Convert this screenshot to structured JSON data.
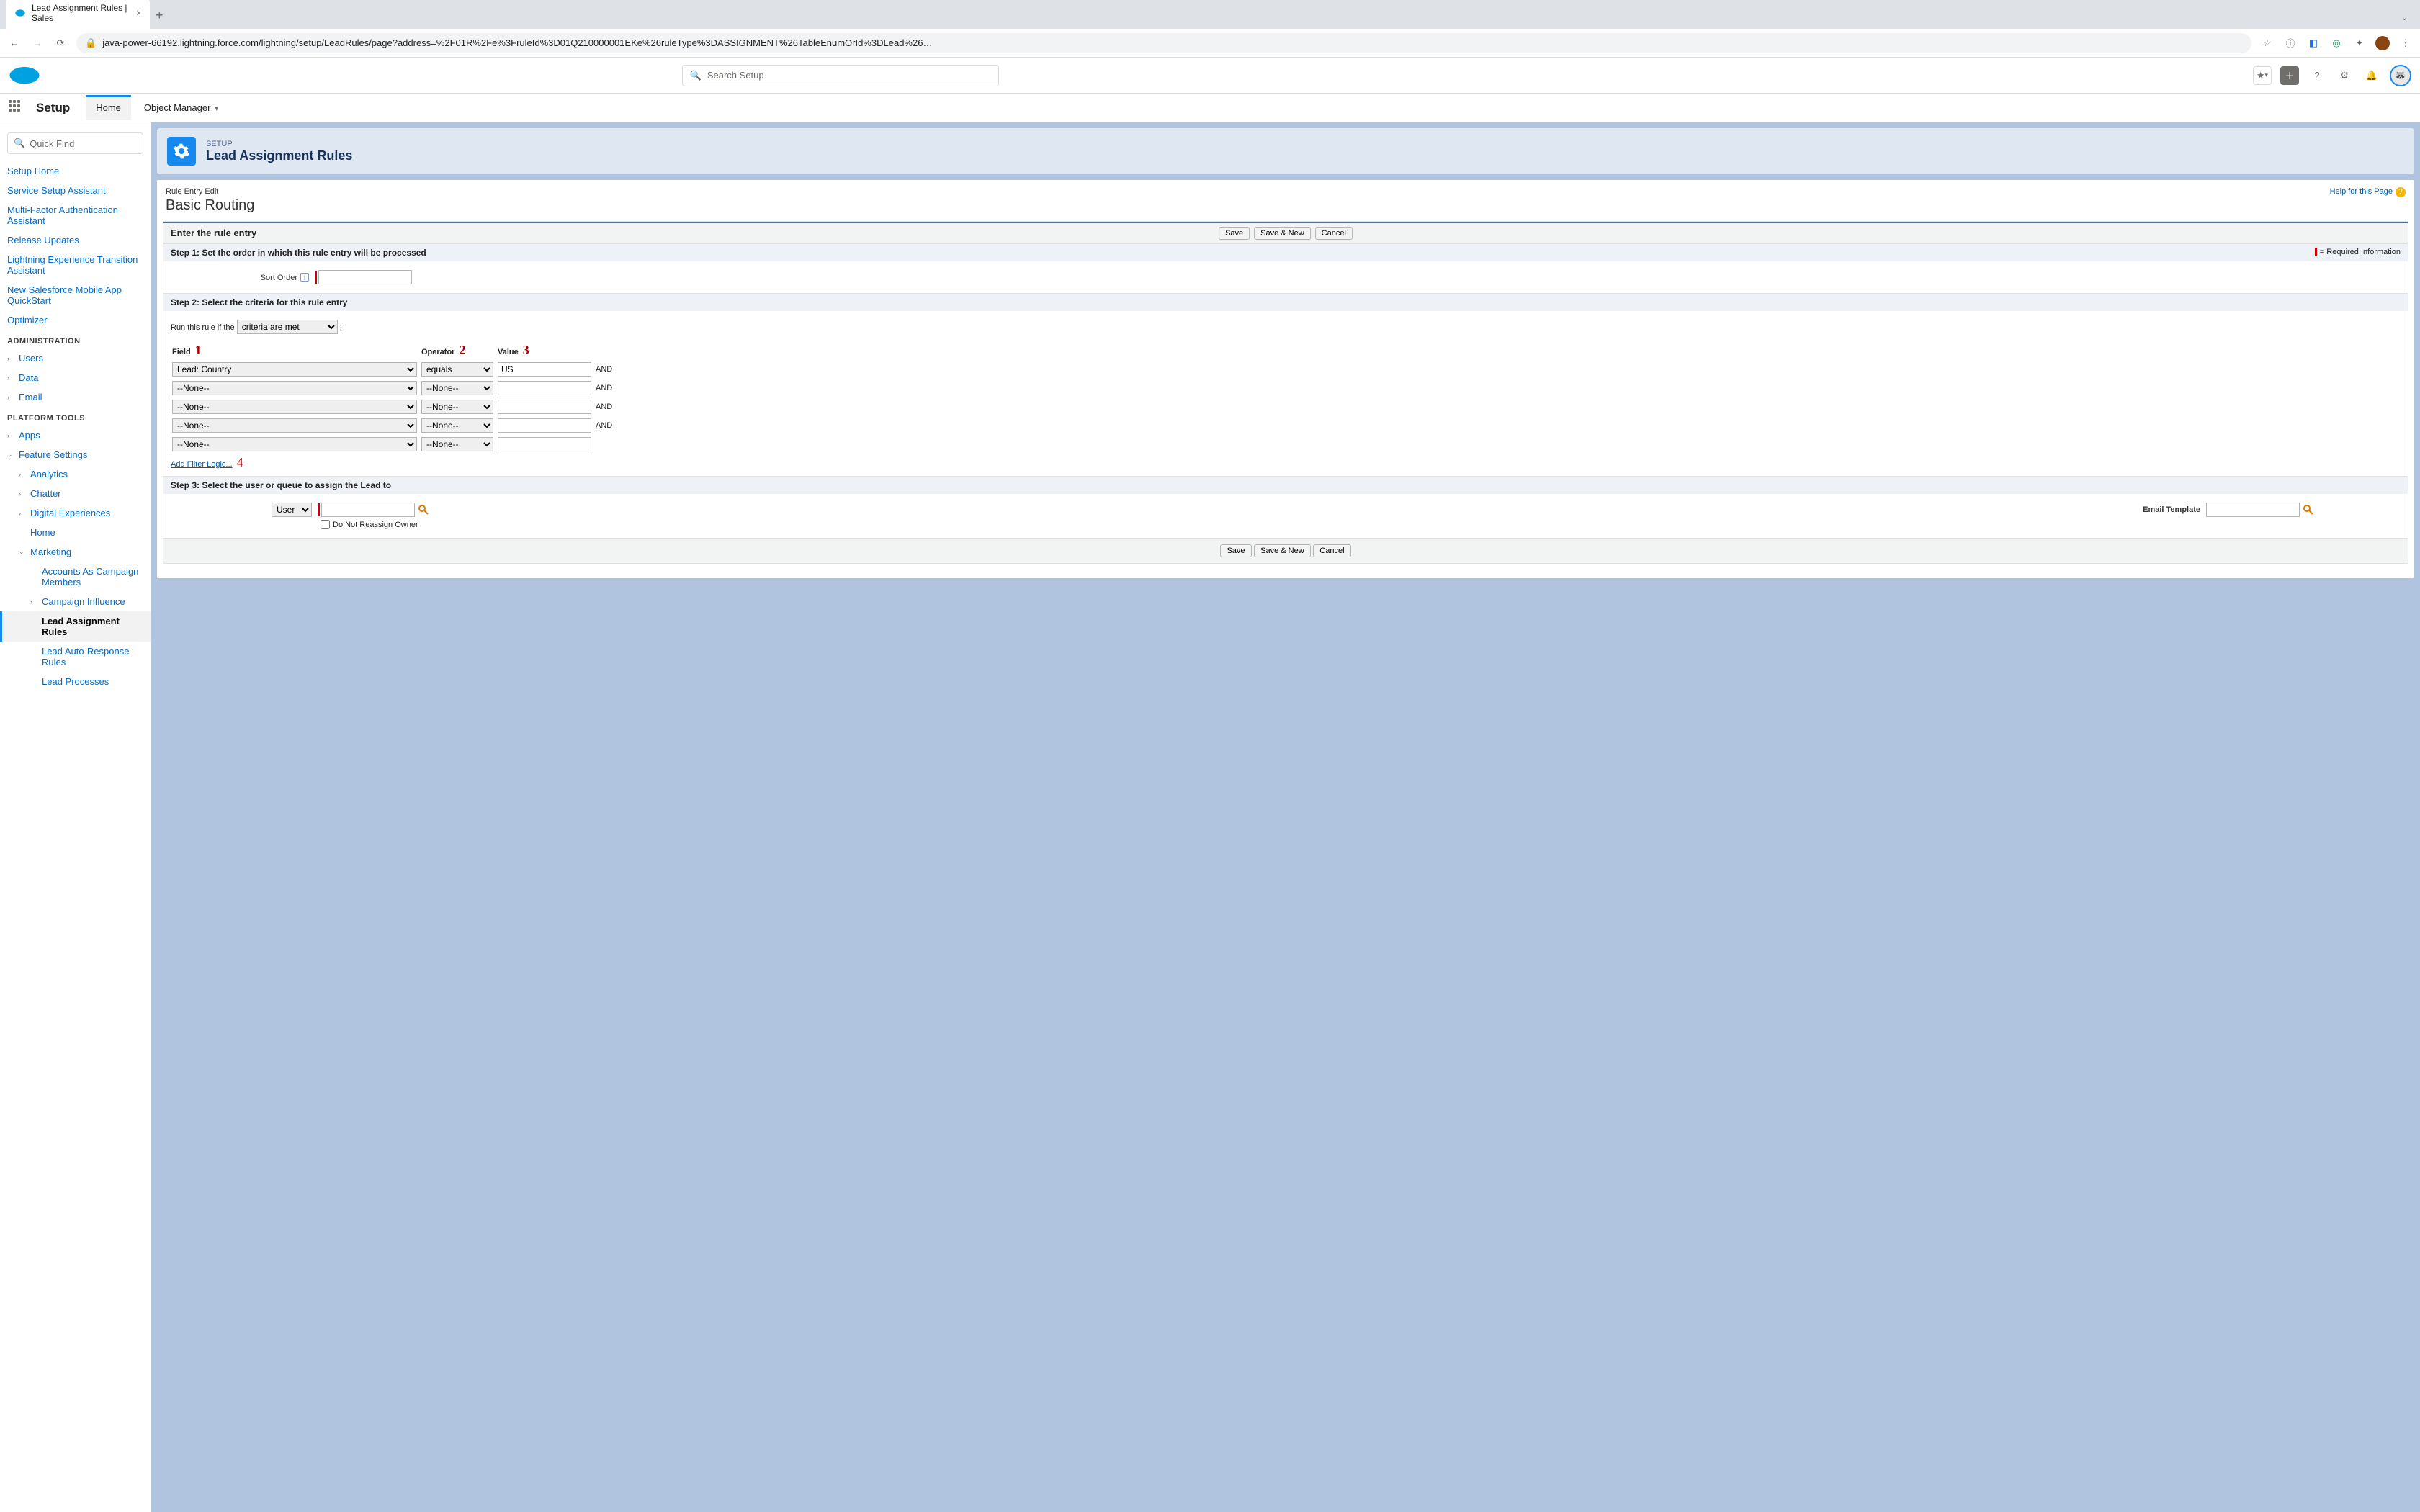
{
  "browser": {
    "tab_title": "Lead Assignment Rules | Sales",
    "url": "java-power-66192.lightning.force.com/lightning/setup/LeadRules/page?address=%2F01R%2Fe%3FruleId%3D01Q210000001EKe%26ruleType%3DASSIGNMENT%26TableEnumOrId%3DLead%26…"
  },
  "sf_header": {
    "search_placeholder": "Search Setup"
  },
  "nav": {
    "setup": "Setup",
    "home": "Home",
    "object_manager": "Object Manager"
  },
  "sidebar": {
    "quick_find": "Quick Find",
    "top": [
      "Setup Home",
      "Service Setup Assistant",
      "Multi-Factor Authentication Assistant",
      "Release Updates",
      "Lightning Experience Transition Assistant",
      "New Salesforce Mobile App QuickStart",
      "Optimizer"
    ],
    "section_admin": "ADMINISTRATION",
    "admin": [
      "Users",
      "Data",
      "Email"
    ],
    "section_platform": "PLATFORM TOOLS",
    "apps": "Apps",
    "feature_settings": "Feature Settings",
    "feature_children": [
      "Analytics",
      "Chatter",
      "Digital Experiences",
      "Home"
    ],
    "marketing": "Marketing",
    "marketing_children": [
      "Accounts As Campaign Members",
      "Campaign Influence",
      "Lead Assignment Rules",
      "Lead Auto-Response Rules",
      "Lead Processes"
    ]
  },
  "hero": {
    "kicker": "SETUP",
    "title": "Lead Assignment Rules"
  },
  "classic": {
    "help": "Help for this Page",
    "breadcrumb": "Rule Entry Edit",
    "heading": "Basic Routing",
    "header_title": "Enter the rule entry",
    "buttons": {
      "save": "Save",
      "save_new": "Save & New",
      "cancel": "Cancel"
    },
    "step1": {
      "title": "Step 1: Set the order in which this rule entry will be processed",
      "req_info": "= Required Information",
      "sort_order": "Sort Order",
      "sort_value": ""
    },
    "step2": {
      "title": "Step 2: Select the criteria for this rule entry",
      "run_rule": "Run this rule if the",
      "condition": "criteria are met",
      "col_field": "Field",
      "col_operator": "Operator",
      "col_value": "Value",
      "and": "AND",
      "ann1": "1",
      "ann2": "2",
      "ann3": "3",
      "ann4": "4",
      "rows": [
        {
          "field": "Lead: Country",
          "operator": "equals",
          "value": "US",
          "and": true
        },
        {
          "field": "--None--",
          "operator": "--None--",
          "value": "",
          "and": true
        },
        {
          "field": "--None--",
          "operator": "--None--",
          "value": "",
          "and": true
        },
        {
          "field": "--None--",
          "operator": "--None--",
          "value": "",
          "and": true
        },
        {
          "field": "--None--",
          "operator": "--None--",
          "value": "",
          "and": false
        }
      ],
      "add_filter": "Add Filter Logic..."
    },
    "step3": {
      "title": "Step 3: Select the user or queue to assign the Lead to",
      "assignee_type": "User",
      "no_reassign": "Do Not Reassign Owner",
      "email_template": "Email Template",
      "assignee_value": "",
      "template_value": ""
    }
  }
}
